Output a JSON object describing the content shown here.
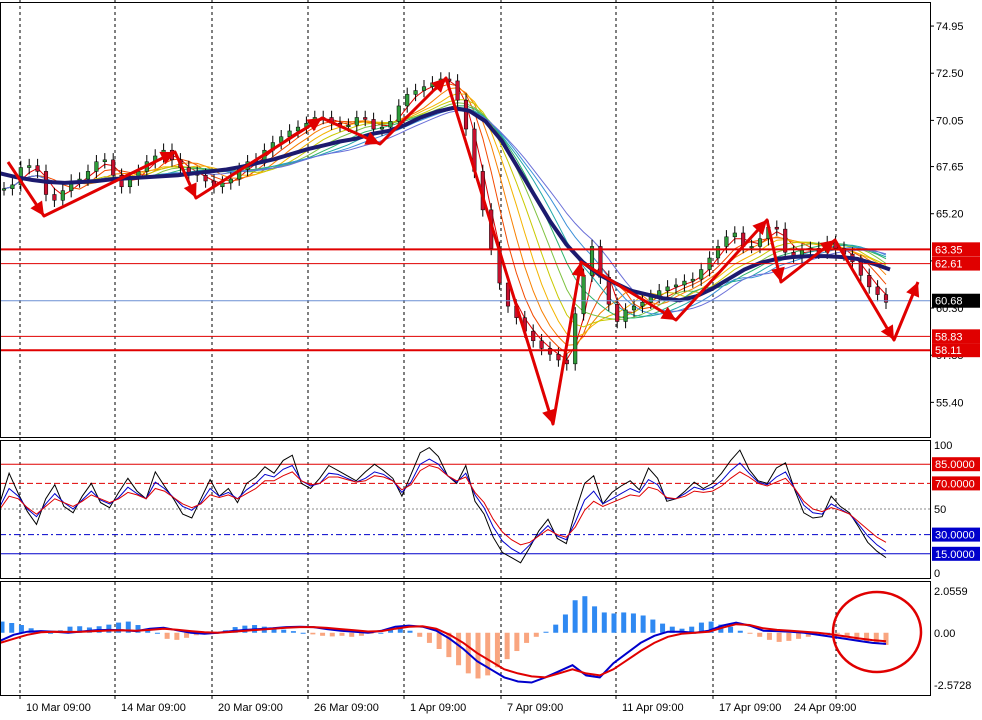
{
  "chart_data": [
    {
      "type": "candlestick",
      "panel": "price",
      "ylim": [
        53.6,
        76.2
      ],
      "y_ticks": [
        "74.95",
        "72.50",
        "70.05",
        "67.65",
        "65.20",
        "62.75",
        "60.30",
        "57.85",
        "55.40"
      ],
      "x_ticks": [
        "10 Mar 09:00",
        "14 Mar 09:00",
        "20 Mar 09:00",
        "26 Mar 09:00",
        "1 Apr 09:00",
        "7 Apr 09:00",
        "11 Apr 09:00",
        "17 Apr 09:00",
        "24 Apr 09:00"
      ],
      "current_price": "60.68",
      "horizontal_levels": [
        {
          "label": "63.35",
          "value": 63.35,
          "color": "#e00000",
          "style": "thick"
        },
        {
          "label": "62.61",
          "value": 62.61,
          "color": "#e00000",
          "style": "thin"
        },
        {
          "label": "58.83",
          "value": 58.83,
          "color": "#e00000",
          "style": "thin"
        },
        {
          "label": "58.11",
          "value": 58.11,
          "color": "#e00000",
          "style": "thick"
        }
      ],
      "close_series": [
        66.5,
        66.7,
        67.6,
        67.7,
        67.4,
        66.2,
        65.9,
        66.4,
        66.9,
        67.0,
        67.4,
        67.9,
        68.0,
        67.2,
        66.6,
        67.0,
        67.4,
        67.9,
        68.2,
        68.5,
        68.0,
        67.6,
        67.3,
        67.2,
        66.9,
        66.6,
        66.8,
        67.0,
        67.5,
        67.9,
        68.0,
        68.5,
        68.9,
        69.2,
        69.5,
        69.7,
        69.9,
        70.2,
        70.2,
        69.9,
        69.8,
        69.8,
        70.2,
        70.1,
        69.6,
        69.7,
        70.0,
        70.8,
        71.4,
        71.6,
        71.8,
        72.0,
        72.2,
        72.1,
        71.1,
        69.6,
        67.4,
        65.4,
        63.4,
        61.6,
        60.4,
        59.8,
        59.1,
        58.6,
        58.2,
        57.9,
        57.6,
        57.4,
        60.0,
        62.0,
        63.5,
        61.9,
        60.5,
        59.6,
        60.2,
        60.4,
        60.6,
        60.9,
        61.2,
        61.4,
        61.5,
        61.7,
        61.8,
        62.3,
        62.9,
        63.5,
        64.0,
        64.2,
        63.5,
        63.5,
        63.9,
        64.5,
        64.4,
        63.2,
        63.0,
        63.3,
        63.4,
        63.2,
        63.7,
        63.4,
        63.1,
        62.7,
        62.0,
        61.4,
        61.0,
        60.6
      ],
      "ma_thick": [
        67.3,
        67.1,
        66.95,
        66.85,
        66.8,
        66.85,
        66.9,
        67.0,
        67.05,
        67.1,
        67.15,
        67.2,
        67.3,
        67.4,
        67.5,
        67.65,
        67.85,
        68.05,
        68.3,
        68.55,
        68.75,
        68.95,
        69.1,
        69.35,
        69.5,
        69.8,
        70.2,
        70.5,
        70.7,
        70.55,
        70.0,
        69.0,
        67.6,
        66.2,
        64.8,
        63.6,
        62.7,
        62.05,
        61.6,
        61.2,
        61.0,
        60.8,
        60.7,
        60.9,
        61.3,
        61.8,
        62.3,
        62.65,
        62.85,
        62.95,
        63.0,
        63.0,
        62.95,
        62.85,
        62.6,
        62.3
      ],
      "annotation": "Trend wave arrows and a circled MACD region marked in red"
    },
    {
      "type": "line",
      "panel": "stochastic",
      "ylim": [
        0,
        100
      ],
      "y_ticks": [
        "100",
        "50",
        "0"
      ],
      "levels": [
        {
          "label": "85.0000",
          "value": 85,
          "color": "#e00000"
        },
        {
          "label": "70.0000",
          "value": 70,
          "color": "#e00000"
        },
        {
          "label": "30.0000",
          "value": 30,
          "color": "#0000cc"
        },
        {
          "label": "15.0000",
          "value": 15,
          "color": "#0000cc"
        }
      ],
      "series": [
        {
          "color": "#000000",
          "values": [
            55,
            78,
            62,
            48,
            38,
            58,
            69,
            52,
            47,
            60,
            70,
            55,
            51,
            63,
            74,
            64,
            58,
            79,
            68,
            58,
            46,
            43,
            58,
            73,
            60,
            66,
            55,
            70,
            75,
            83,
            78,
            88,
            92,
            70,
            66,
            74,
            84,
            80,
            76,
            72,
            79,
            85,
            80,
            74,
            60,
            77,
            94,
            98,
            91,
            76,
            70,
            84,
            56,
            46,
            28,
            16,
            12,
            8,
            20,
            33,
            42,
            27,
            23,
            48,
            70,
            76,
            54,
            63,
            68,
            72,
            65,
            82,
            74,
            56,
            58,
            64,
            71,
            66,
            70,
            78,
            88,
            96,
            81,
            72,
            70,
            82,
            86,
            65,
            47,
            43,
            44,
            60,
            52,
            47,
            36,
            24,
            17,
            12
          ]
        },
        {
          "color": "#0000cc",
          "values": [
            52,
            66,
            60,
            50,
            44,
            54,
            62,
            55,
            50,
            57,
            64,
            57,
            54,
            59,
            67,
            62,
            58,
            71,
            66,
            59,
            52,
            49,
            55,
            66,
            60,
            63,
            58,
            65,
            70,
            77,
            75,
            81,
            84,
            72,
            68,
            70,
            78,
            77,
            74,
            71,
            74,
            79,
            77,
            72,
            63,
            71,
            85,
            89,
            85,
            76,
            71,
            78,
            61,
            51,
            36,
            25,
            19,
            15,
            22,
            30,
            37,
            29,
            26,
            40,
            57,
            64,
            54,
            58,
            62,
            66,
            63,
            73,
            69,
            58,
            58,
            62,
            67,
            65,
            67,
            72,
            80,
            86,
            78,
            71,
            69,
            75,
            79,
            66,
            53,
            47,
            46,
            54,
            50,
            46,
            38,
            29,
            22,
            17
          ]
        },
        {
          "color": "#e00000",
          "values": [
            50,
            60,
            58,
            51,
            46,
            52,
            58,
            55,
            52,
            56,
            61,
            58,
            55,
            58,
            63,
            61,
            58,
            66,
            64,
            59,
            54,
            51,
            54,
            61,
            59,
            61,
            58,
            62,
            66,
            72,
            72,
            76,
            79,
            72,
            69,
            70,
            75,
            75,
            73,
            71,
            72,
            76,
            75,
            72,
            65,
            69,
            80,
            84,
            82,
            76,
            72,
            75,
            63,
            55,
            42,
            32,
            26,
            22,
            24,
            29,
            34,
            30,
            28,
            36,
            49,
            56,
            52,
            55,
            58,
            61,
            60,
            67,
            65,
            59,
            58,
            60,
            64,
            63,
            64,
            68,
            74,
            79,
            75,
            70,
            68,
            71,
            74,
            66,
            56,
            50,
            48,
            51,
            49,
            46,
            40,
            34,
            28,
            24
          ]
        }
      ]
    },
    {
      "type": "bar",
      "panel": "macd",
      "ylim": [
        -2.5728,
        2.0559
      ],
      "y_ticks": [
        "2.0559",
        "0.00",
        "-2.5728"
      ],
      "positive_color": "#2f89f2",
      "negative_color": "#f9a57f",
      "histogram": [
        0.55,
        0.48,
        0.38,
        0.22,
        0.05,
        0.0,
        0.12,
        0.3,
        0.32,
        0.26,
        0.32,
        0.4,
        0.5,
        0.55,
        0.38,
        0.2,
        0.0,
        -0.3,
        -0.35,
        -0.25,
        -0.12,
        -0.05,
        0.0,
        0.12,
        0.28,
        0.35,
        0.38,
        0.3,
        0.22,
        0.15,
        0.08,
        0.0,
        -0.08,
        -0.15,
        -0.18,
        -0.15,
        -0.2,
        -0.15,
        -0.05,
        0.0,
        0.15,
        0.22,
        0.1,
        -0.2,
        -0.5,
        -0.8,
        -1.2,
        -1.6,
        -2.0,
        -2.25,
        -2.1,
        -1.7,
        -1.3,
        -0.9,
        -0.5,
        -0.2,
        0.05,
        0.4,
        0.9,
        1.6,
        1.8,
        1.3,
        1.0,
        0.95,
        1.0,
        0.95,
        0.85,
        0.65,
        0.45,
        0.3,
        0.2,
        0.3,
        0.5,
        0.55,
        0.4,
        0.3,
        0.1,
        -0.05,
        -0.2,
        -0.35,
        -0.45,
        -0.4,
        -0.3,
        -0.2,
        -0.1,
        0.0,
        -0.05,
        -0.2,
        -0.35,
        -0.45,
        -0.55,
        -0.6
      ],
      "series": [
        {
          "color": "#0000cc",
          "values": [
            -0.4,
            -0.1,
            0.05,
            0.08,
            0.05,
            0.0,
            0.06,
            0.12,
            0.14,
            0.12,
            0.08,
            0.2,
            0.25,
            0.12,
            0.0,
            -0.05,
            0.0,
            0.08,
            0.14,
            0.18,
            0.22,
            0.28,
            0.3,
            0.28,
            0.18,
            0.1,
            0.05,
            0.0,
            0.1,
            0.3,
            0.35,
            0.3,
            0.1,
            -0.3,
            -0.8,
            -1.4,
            -1.8,
            -2.2,
            -2.4,
            -2.45,
            -2.2,
            -1.9,
            -1.6,
            -2.1,
            -2.2,
            -1.5,
            -1.0,
            -0.5,
            -0.15,
            0.05,
            0.05,
            0.0,
            0.1,
            0.35,
            0.5,
            0.35,
            0.1,
            0.08,
            0.05,
            0.0,
            -0.1,
            -0.2,
            -0.3,
            -0.4,
            -0.5,
            -0.55
          ]
        },
        {
          "color": "#e00000",
          "values": [
            -0.5,
            -0.3,
            -0.1,
            0.02,
            0.05,
            0.04,
            0.05,
            0.08,
            0.11,
            0.12,
            0.1,
            0.14,
            0.2,
            0.15,
            0.08,
            0.02,
            0.0,
            0.04,
            0.1,
            0.15,
            0.2,
            0.25,
            0.28,
            0.28,
            0.24,
            0.18,
            0.12,
            0.06,
            0.08,
            0.2,
            0.3,
            0.32,
            0.2,
            -0.1,
            -0.5,
            -1.0,
            -1.4,
            -1.8,
            -2.0,
            -2.15,
            -2.2,
            -2.0,
            -1.8,
            -2.0,
            -2.1,
            -1.8,
            -1.35,
            -0.9,
            -0.5,
            -0.2,
            -0.05,
            0.0,
            0.05,
            0.25,
            0.42,
            0.38,
            0.22,
            0.14,
            0.1,
            0.05,
            0.0,
            -0.08,
            -0.18,
            -0.28,
            -0.36,
            -0.42
          ]
        }
      ]
    }
  ]
}
